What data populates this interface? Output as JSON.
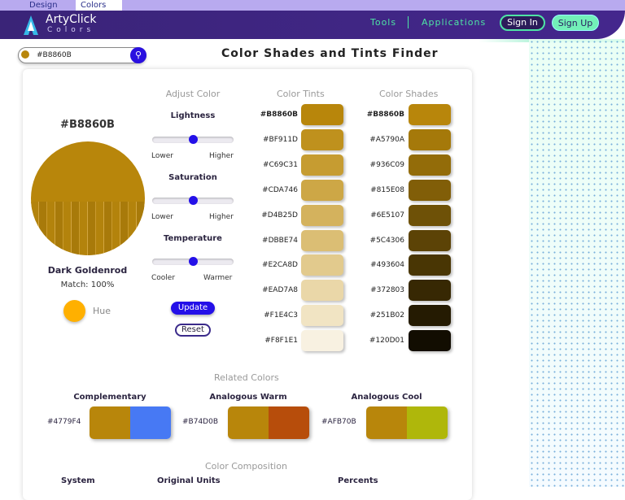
{
  "top_tabs": {
    "design": "Design",
    "colors": "Colors"
  },
  "header": {
    "logo_line1": "ArtyClick",
    "logo_line2": "Colors",
    "tools": "Tools",
    "applications": "Applications",
    "sign_in": "Sign In",
    "sign_up": "Sign Up"
  },
  "search": {
    "value": "#B8860B",
    "color": "#B8860B"
  },
  "page_title": "Color Shades and Tints Finder",
  "main_color": {
    "hex": "#B8860B",
    "name": "Dark Goldenrod",
    "match": "Match: 100%",
    "hue_label": "Hue",
    "hue_color": "#FFB000"
  },
  "adjust": {
    "title": "Adjust Color",
    "sliders": [
      {
        "label": "Lightness",
        "low": "Lower",
        "high": "Higher",
        "value": 0.5
      },
      {
        "label": "Saturation",
        "low": "Lower",
        "high": "Higher",
        "value": 0.5
      },
      {
        "label": "Temperature",
        "low": "Cooler",
        "high": "Warmer",
        "value": 0.5
      }
    ],
    "update": "Update",
    "reset": "Reset"
  },
  "tints": {
    "title": "Color Tints",
    "items": [
      "#B8860B",
      "#BF911D",
      "#C69C31",
      "#CDA746",
      "#D4B25D",
      "#DBBE74",
      "#E2CA8D",
      "#EAD7A8",
      "#F1E4C3",
      "#F8F1E1"
    ]
  },
  "shades": {
    "title": "Color Shades",
    "items": [
      "#B8860B",
      "#A5790A",
      "#936C09",
      "#815E08",
      "#6E5107",
      "#5C4306",
      "#493604",
      "#372803",
      "#251B02",
      "#120D01"
    ]
  },
  "related": {
    "title": "Related Colors",
    "groups": [
      {
        "title": "Complementary",
        "hex": "#4779F4",
        "base": "#B8860B"
      },
      {
        "title": "Analogous Warm",
        "hex": "#B74D0B",
        "base": "#B8860B"
      },
      {
        "title": "Analogous Cool",
        "hex": "#AFB70B",
        "base": "#B8860B"
      }
    ]
  },
  "composition": {
    "title": "Color Composition",
    "headers": [
      "System",
      "Original Units",
      "Percents"
    ]
  }
}
